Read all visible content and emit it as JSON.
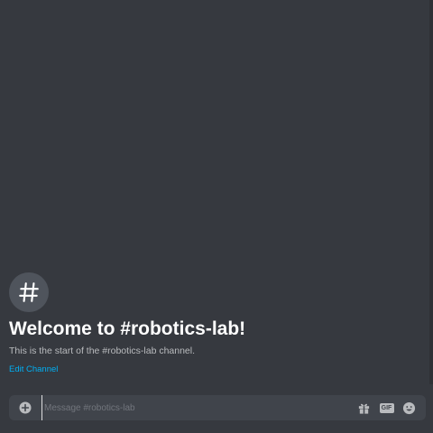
{
  "channel": {
    "name": "robotics-lab",
    "icon": "hashtag-icon"
  },
  "welcome": {
    "title": "Welcome to #robotics-lab!",
    "subtitle": "This is the start of the #robotics-lab channel.",
    "edit_link": "Edit Channel"
  },
  "composer": {
    "placeholder": "Message #robotics-lab",
    "value": "",
    "buttons": {
      "attach_icon": "plus-circle-icon",
      "gift_icon": "gift-icon",
      "gif_label": "GIF",
      "emoji_icon": "emoji-smile-icon"
    }
  },
  "colors": {
    "background": "#36393f",
    "input_background": "#40444b",
    "link": "#00b0f4",
    "title": "#ffffff",
    "muted_text": "#b9bbbe"
  }
}
